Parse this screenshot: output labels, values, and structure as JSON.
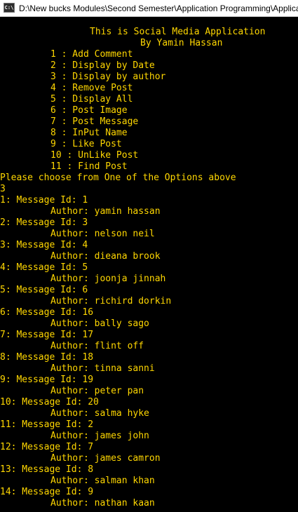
{
  "window": {
    "title": "D:\\New bucks Modules\\Second Semester\\Application Programming\\Applica",
    "icon": "console-app-icon",
    "icon_label": "C:\\",
    "text_color": "#ffd700",
    "background": "#000000"
  },
  "console": {
    "header_title": "This is Social Media Application",
    "header_author": "By Yamin Hassan",
    "menu": [
      "1 : Add Comment",
      "2 : Display by Date",
      "3 : Display by author",
      "4 : Remove Post",
      "5 : Display All",
      "6 : Post Image",
      "7 : Post Message",
      "8 : InPut Name",
      "9 : Like Post",
      "10 : UnLike Post",
      "11 : Find Post"
    ],
    "prompt": "Please choose from One of the Options above",
    "user_input": "3",
    "results": [
      {
        "message": "1: Message Id: 1",
        "author": "Author: yamin hassan"
      },
      {
        "message": "2: Message Id: 3",
        "author": "Author: nelson neil"
      },
      {
        "message": "3: Message Id: 4",
        "author": "Author: dieana brook"
      },
      {
        "message": "4: Message Id: 5",
        "author": "Author: joonja jinnah"
      },
      {
        "message": "5: Message Id: 6",
        "author": "Author: richird dorkin"
      },
      {
        "message": "6: Message Id: 16",
        "author": "Author: bally sago"
      },
      {
        "message": "7: Message Id: 17",
        "author": "Author: flint off"
      },
      {
        "message": "8: Message Id: 18",
        "author": "Author: tinna sanni"
      },
      {
        "message": "9: Message Id: 19",
        "author": "Author: peter pan"
      },
      {
        "message": "10: Message Id: 20",
        "author": "Author: salma hyke"
      },
      {
        "message": "11: Message Id: 2",
        "author": "Author: james john"
      },
      {
        "message": "12: Message Id: 7",
        "author": "Author: james camron"
      },
      {
        "message": "13: Message Id: 8",
        "author": "Author: salman khan"
      },
      {
        "message": "14: Message Id: 9",
        "author": "Author: nathan kaan"
      }
    ]
  }
}
